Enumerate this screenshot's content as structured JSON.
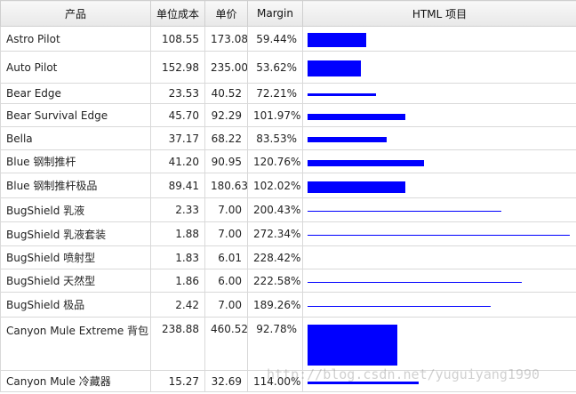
{
  "table": {
    "headers": {
      "product": "产品",
      "unit_cost": "单位成本",
      "unit_price": "单价",
      "margin": "Margin",
      "html_item": "HTML 项目"
    },
    "rows": [
      {
        "product": "Astro Pilot",
        "unit_cost": "108.55",
        "unit_price": "173.08",
        "margin": "59.44%",
        "bar": {
          "length": 0.22,
          "thickness": 0.72
        }
      },
      {
        "product": "Auto Pilot",
        "unit_cost": "152.98",
        "unit_price": "235.00",
        "margin": "53.62%",
        "bar": {
          "length": 0.2,
          "thickness": 0.6
        }
      },
      {
        "product": "Bear Edge",
        "unit_cost": "23.53",
        "unit_price": "40.52",
        "margin": "72.21%",
        "bar": {
          "length": 0.26,
          "thickness": 0.17
        }
      },
      {
        "product": "Bear Survival Edge",
        "unit_cost": "45.70",
        "unit_price": "92.29",
        "margin": "101.97%",
        "bar": {
          "length": 0.37,
          "thickness": 0.35
        }
      },
      {
        "product": "Bella",
        "unit_cost": "37.17",
        "unit_price": "68.22",
        "margin": "83.53%",
        "bar": {
          "length": 0.3,
          "thickness": 0.3
        }
      },
      {
        "product": "Blue 钢制推杆",
        "unit_cost": "41.20",
        "unit_price": "90.95",
        "margin": "120.76%",
        "bar": {
          "length": 0.44,
          "thickness": 0.35
        }
      },
      {
        "product": "Blue 钢制推杆极品",
        "unit_cost": "89.41",
        "unit_price": "180.63",
        "margin": "102.02%",
        "bar": {
          "length": 0.37,
          "thickness": 0.6
        }
      },
      {
        "product": "BugShield 乳液",
        "unit_cost": "2.33",
        "unit_price": "7.00",
        "margin": "200.43%",
        "bar": {
          "length": 0.73,
          "thickness": 0.05
        }
      },
      {
        "product": "BugShield 乳液套装",
        "unit_cost": "1.88",
        "unit_price": "7.00",
        "margin": "272.34%",
        "bar": {
          "length": 0.99,
          "thickness": 0.05
        }
      },
      {
        "product": "BugShield 喷射型",
        "unit_cost": "1.83",
        "unit_price": "6.01",
        "margin": "228.42%",
        "bar": {
          "length": 0.83,
          "thickness": 0.0
        }
      },
      {
        "product": "BugShield 天然型",
        "unit_cost": "1.86",
        "unit_price": "6.00",
        "margin": "222.58%",
        "bar": {
          "length": 0.81,
          "thickness": 0.05
        }
      },
      {
        "product": "BugShield 极品",
        "unit_cost": "2.42",
        "unit_price": "7.00",
        "margin": "189.26%",
        "bar": {
          "length": 0.69,
          "thickness": 0.05
        }
      },
      {
        "product": "Canyon Mule Extreme 背包",
        "unit_cost": "238.88",
        "unit_price": "460.52",
        "margin": "92.78%",
        "bar": {
          "length": 0.34,
          "thickness": 0.85
        }
      },
      {
        "product": "Canyon Mule 冷藏器",
        "unit_cost": "15.27",
        "unit_price": "32.69",
        "margin": "114.00%",
        "bar": {
          "length": 0.42,
          "thickness": 0.15
        }
      }
    ]
  },
  "watermark": "http://blog.csdn.net/yuguiyang1990"
}
